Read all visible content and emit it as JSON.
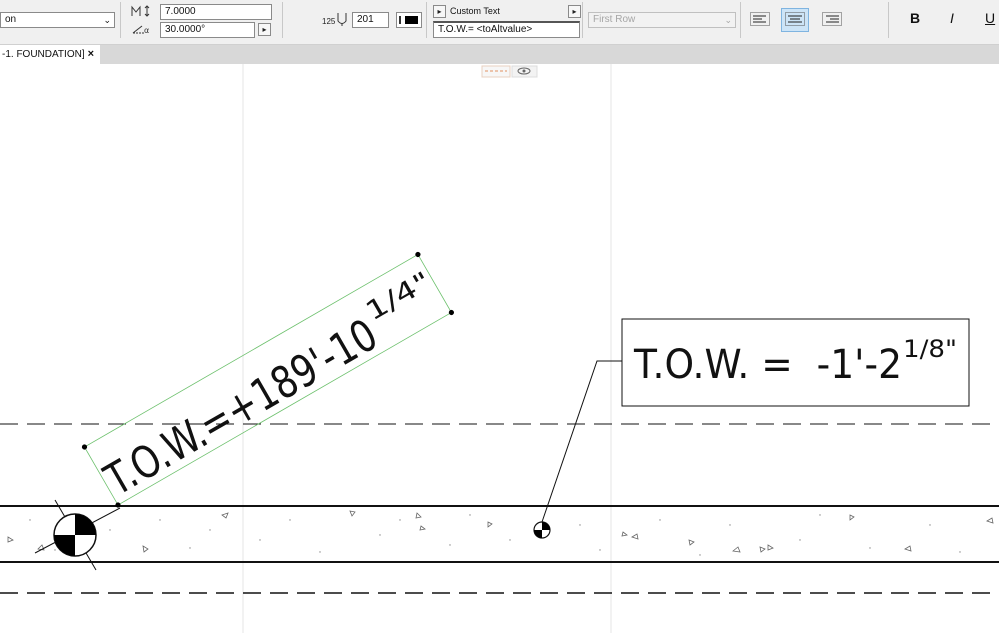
{
  "toolbar": {
    "layer_select": "on",
    "width_value": "7.0000",
    "angle_value": "30.0000°",
    "scale_label": "125",
    "pen_value": "201",
    "text_source_label": "Custom Text",
    "text_expression": "T.O.W.= <toAltvalue>",
    "row_select": "First Row",
    "bold": "B",
    "italic": "I",
    "underline": "U"
  },
  "tab": {
    "label": "-1. FOUNDATION]",
    "close": "×"
  },
  "drawing": {
    "rotated_label": {
      "prefix": "T.O.W.=+189'-10",
      "fraction": "1/4\""
    },
    "boxed_label": {
      "prefix": "T.O.W. =  -1'-2",
      "fraction": "1/8\""
    }
  }
}
